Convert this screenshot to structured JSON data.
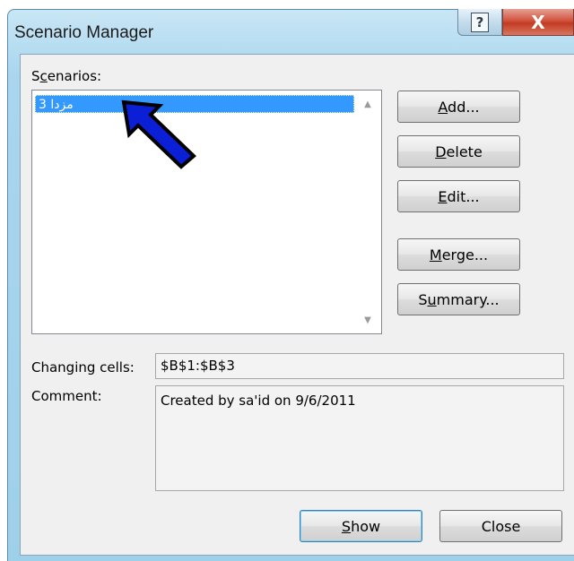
{
  "window": {
    "title": "Scenario Manager",
    "help_glyph": "?",
    "close_glyph": "X"
  },
  "scenarios": {
    "label_pre": "S",
    "label_u": "c",
    "label_post": "enarios:",
    "items": [
      "مزدا 3"
    ]
  },
  "buttons": {
    "add": {
      "u": "A",
      "rest": "dd..."
    },
    "delete": {
      "u": "D",
      "rest": "elete"
    },
    "edit": {
      "u": "E",
      "rest": "dit..."
    },
    "merge": {
      "pre": "",
      "u": "M",
      "rest": "erge..."
    },
    "summary": {
      "pre": "S",
      "u": "u",
      "rest": "mmary..."
    },
    "show": {
      "u": "S",
      "rest": "how"
    },
    "close": "Close"
  },
  "details": {
    "changing_cells_label": "Changing cells:",
    "changing_cells_value": "$B$1:$B$3",
    "comment_label": "Comment:",
    "comment_value": "Created by sa'id on 9/6/2011"
  },
  "colors": {
    "selection": "#3399ff",
    "annotation_arrow_fill": "#0a1fd6",
    "close_button": "#c9442d"
  }
}
